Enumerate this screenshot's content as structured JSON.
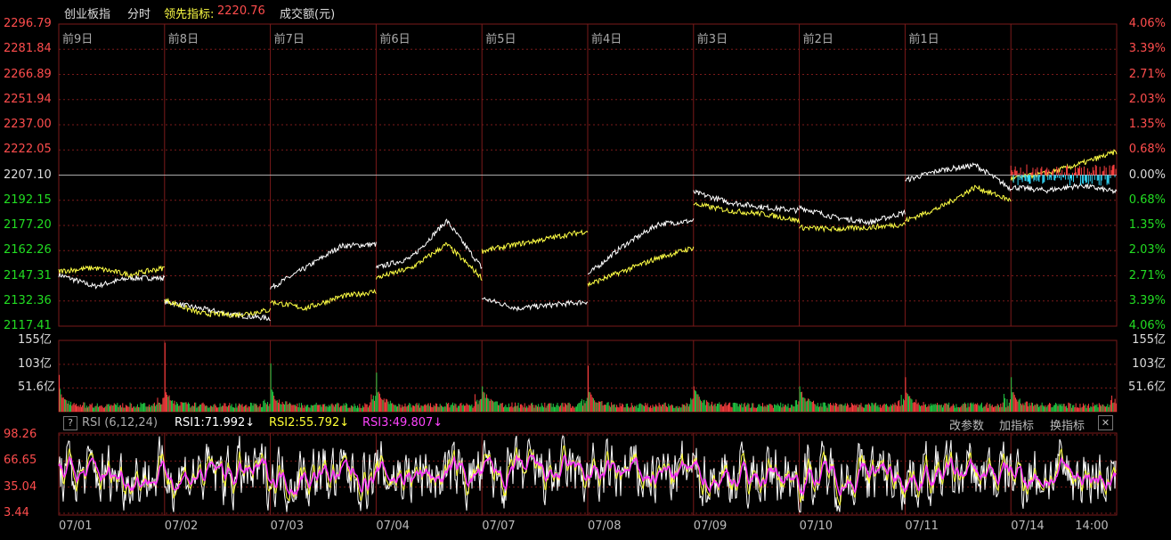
{
  "header": {
    "name": "创业板指",
    "mode": "分时",
    "lead_label": "领先指标:",
    "lead_value": "2220.76",
    "vol_label": "成交额(元)"
  },
  "chart_data": [
    {
      "type": "line",
      "panel": "price",
      "prev_close": 2207.1,
      "ylim": [
        2117.41,
        2296.79
      ],
      "yticks_left": [
        "2296.79",
        "2281.84",
        "2266.89",
        "2251.94",
        "2237.00",
        "2222.05",
        "2207.10",
        "2192.15",
        "2177.20",
        "2162.26",
        "2147.31",
        "2132.36",
        "2117.41"
      ],
      "yticks_right": [
        "4.06%",
        "3.39%",
        "2.71%",
        "2.03%",
        "1.35%",
        "0.68%",
        "0.00%",
        "0.68%",
        "1.35%",
        "2.03%",
        "2.71%",
        "3.39%",
        "4.06%"
      ],
      "day_labels": [
        "前9日",
        "前8日",
        "前7日",
        "前6日",
        "前5日",
        "前4日",
        "前3日",
        "前2日",
        "前1日"
      ],
      "x_dates": [
        "07/01",
        "07/02",
        "07/03",
        "07/04",
        "07/07",
        "07/08",
        "07/09",
        "07/10",
        "07/11",
        "07/14"
      ],
      "series": [
        {
          "color": "#ffffff",
          "values": [
            [
              2148,
              2141,
              2146,
              2146
            ],
            [
              2132,
              2128,
              2124,
              2122
            ],
            [
              2140,
              2152,
              2165,
              2166
            ],
            [
              2152,
              2158,
              2180,
              2152
            ],
            [
              2134,
              2128,
              2130,
              2132
            ],
            [
              2148,
              2165,
              2178,
              2180
            ],
            [
              2197,
              2191,
              2188,
              2186
            ],
            [
              2188,
              2182,
              2179,
              2185
            ],
            [
              2204,
              2210,
              2213,
              2199
            ],
            [
              2200,
              2198,
              2201,
              2197
            ]
          ]
        },
        {
          "color": "#ffff44",
          "values": [
            [
              2150,
              2152,
              2148,
              2152
            ],
            [
              2133,
              2125,
              2124,
              2127
            ],
            [
              2132,
              2128,
              2135,
              2138
            ],
            [
              2146,
              2152,
              2166,
              2146
            ],
            [
              2162,
              2166,
              2170,
              2174
            ],
            [
              2142,
              2150,
              2158,
              2164
            ],
            [
              2190,
              2186,
              2184,
              2180
            ],
            [
              2176,
              2175,
              2176,
              2178
            ],
            [
              2180,
              2188,
              2200,
              2192
            ],
            [
              2205,
              2208,
              2214,
              2221
            ]
          ]
        }
      ]
    },
    {
      "type": "bar",
      "panel": "volume",
      "unit": "亿",
      "yticks": [
        "155亿",
        "103亿",
        "51.6亿"
      ],
      "ylim": [
        0,
        155
      ],
      "day_open_peak": [
        80,
        150,
        105,
        85,
        55,
        100,
        55,
        55,
        75,
        75
      ],
      "bar_colors": [
        "#ff4040",
        "#22cc44"
      ]
    },
    {
      "type": "line",
      "panel": "rsi",
      "title": "RSI (6,12,24)",
      "yticks": [
        "98.26",
        "66.65",
        "35.04",
        "3.44"
      ],
      "ylim": [
        3.44,
        98.26
      ],
      "series": [
        {
          "name": "RSI1",
          "value": "71.992",
          "color": "#ffffff"
        },
        {
          "name": "RSI2",
          "value": "55.792",
          "color": "#ffff33"
        },
        {
          "name": "RSI3",
          "value": "49.807",
          "color": "#ff33ff"
        }
      ]
    }
  ],
  "rsi_bar": {
    "q": "?",
    "title": "RSI (6,12,24)",
    "rsi1": "RSI1:71.992↓",
    "rsi2": "RSI2:55.792↓",
    "rsi3": "RSI3:49.807↓",
    "btn_params": "改参数",
    "btn_add": "加指标",
    "btn_switch": "换指标",
    "close": "✕"
  },
  "time_last": "14:00",
  "colors": {
    "up": "#ff4d4d",
    "down": "#22dd22",
    "grid": "#7a1a1a"
  }
}
